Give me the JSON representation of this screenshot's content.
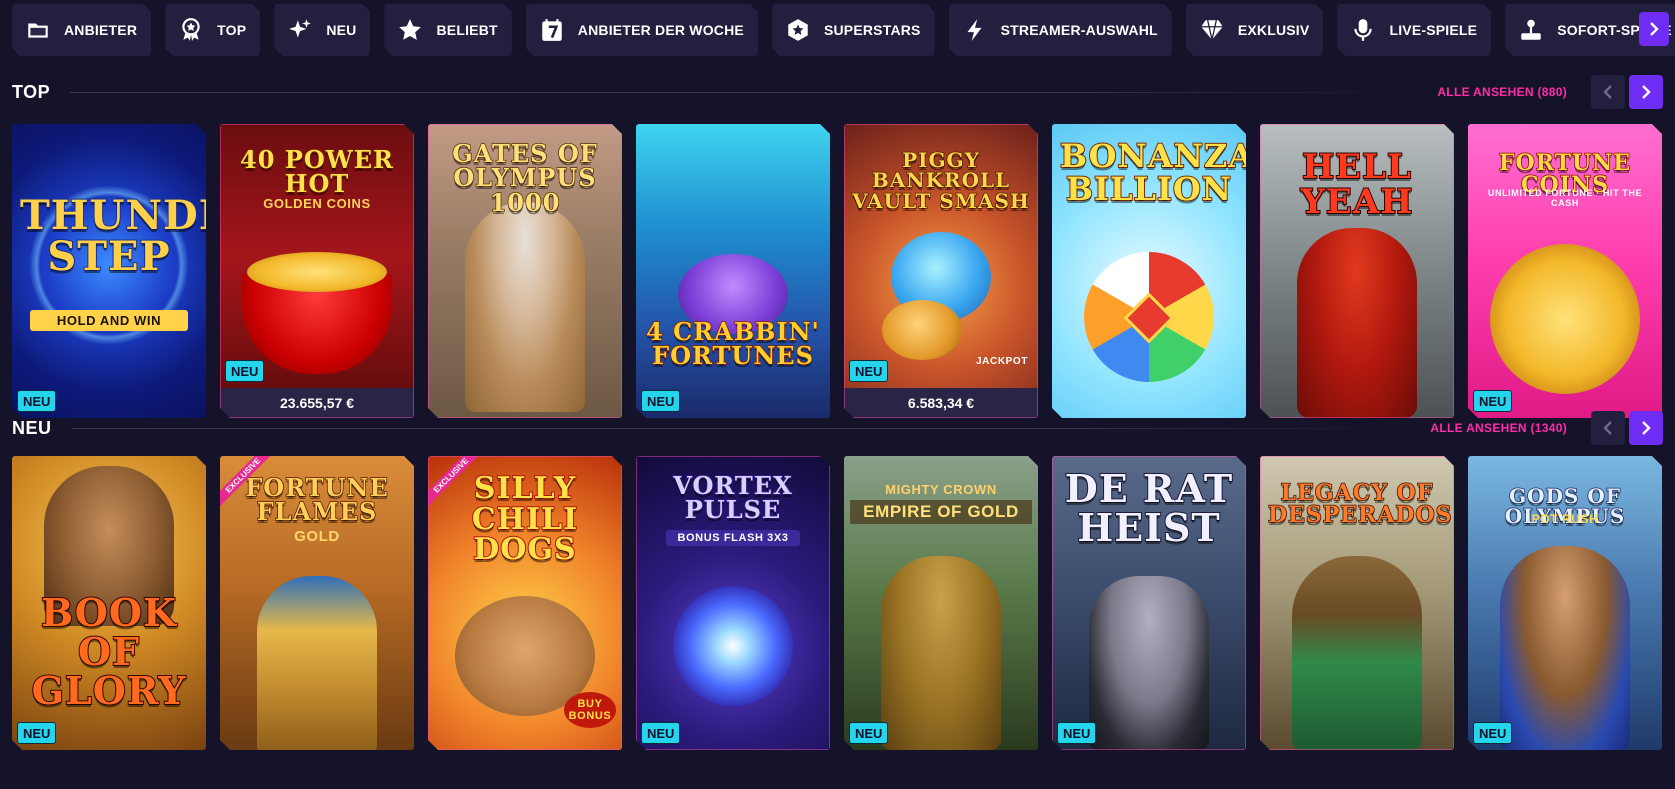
{
  "nav": {
    "categories": [
      {
        "label": "ANBIETER",
        "icon": "folder-icon"
      },
      {
        "label": "TOP",
        "icon": "award-ribbon-icon"
      },
      {
        "label": "NEU",
        "icon": "sparkle-icon"
      },
      {
        "label": "BELIEBT",
        "icon": "star-icon"
      },
      {
        "label": "ANBIETER DER WOCHE",
        "icon": "calendar-seven-icon"
      },
      {
        "label": "SUPERSTARS",
        "icon": "hexagon-star-icon"
      },
      {
        "label": "STREAMER-AUSWAHL",
        "icon": "lightning-icon"
      },
      {
        "label": "EXKLUSIV",
        "icon": "diamond-icon"
      },
      {
        "label": "LIVE-SPIELE",
        "icon": "microphone-icon"
      },
      {
        "label": "SOFORT-SPIELE",
        "icon": "joystick-icon"
      }
    ],
    "next_icon": "chevron-right-icon"
  },
  "sections": {
    "top": {
      "title": "TOP",
      "see_all": "ALLE ANSEHEN (880)",
      "games": [
        {
          "name": "THUNDER STEP",
          "subtitle": "HOLD AND WIN",
          "badge": "NEU",
          "jackpot": ""
        },
        {
          "name": "40 POWER HOT",
          "subtitle": "GOLDEN COINS",
          "badge": "NEU",
          "jackpot": "23.655,57 €"
        },
        {
          "name": "GATES OF OLYMPUS 1000",
          "subtitle": "",
          "badge": "",
          "jackpot": ""
        },
        {
          "name": "4 CRABBIN' FORTUNES",
          "subtitle": "",
          "badge": "NEU",
          "jackpot": ""
        },
        {
          "name": "PIGGY BANKROLL VAULT SMASH",
          "subtitle": "JACKPOT",
          "badge": "NEU",
          "jackpot": "6.583,34 €"
        },
        {
          "name": "BONANZA BILLION",
          "subtitle": "",
          "badge": "",
          "jackpot": ""
        },
        {
          "name": "HELL YEAH",
          "subtitle": "",
          "badge": "",
          "jackpot": ""
        },
        {
          "name": "FORTUNE COINS",
          "subtitle": "UNLIMITED FORTUNE · HIT THE CASH",
          "badge": "NEU",
          "jackpot": ""
        }
      ]
    },
    "neu": {
      "title": "NEU",
      "see_all": "ALLE ANSEHEN (1340)",
      "games": [
        {
          "name": "BOOK OF GLORY",
          "subtitle": "",
          "badge": "NEU",
          "exclusive": ""
        },
        {
          "name": "FORTUNE FLAMES",
          "subtitle": "GOLD",
          "badge": "",
          "exclusive": "EXCLUSIVE"
        },
        {
          "name": "SILLY CHILI DOGS",
          "subtitle": "BUY BONUS",
          "badge": "",
          "exclusive": "EXCLUSIVE"
        },
        {
          "name": "VORTEX PULSE",
          "subtitle": "BONUS FLASH 3x3",
          "badge": "NEU",
          "exclusive": ""
        },
        {
          "name": "MIGHTY CROWN",
          "subtitle": "EMPIRE OF GOLD",
          "badge": "NEU",
          "exclusive": ""
        },
        {
          "name": "DE RAT HEIST",
          "subtitle": "",
          "badge": "NEU",
          "exclusive": ""
        },
        {
          "name": "LEGACY OF DESPERADOS",
          "subtitle": "",
          "badge": "",
          "exclusive": ""
        },
        {
          "name": "GODS OF OLYMPUS",
          "subtitle": "POT RUSH",
          "badge": "NEU",
          "exclusive": ""
        }
      ]
    }
  },
  "colors": {
    "background": "#15132a",
    "accent_purple": "#6f2cf2",
    "accent_pink": "#ff2da8",
    "badge_cyan": "#24d5ec",
    "chip": "#221f3f"
  }
}
